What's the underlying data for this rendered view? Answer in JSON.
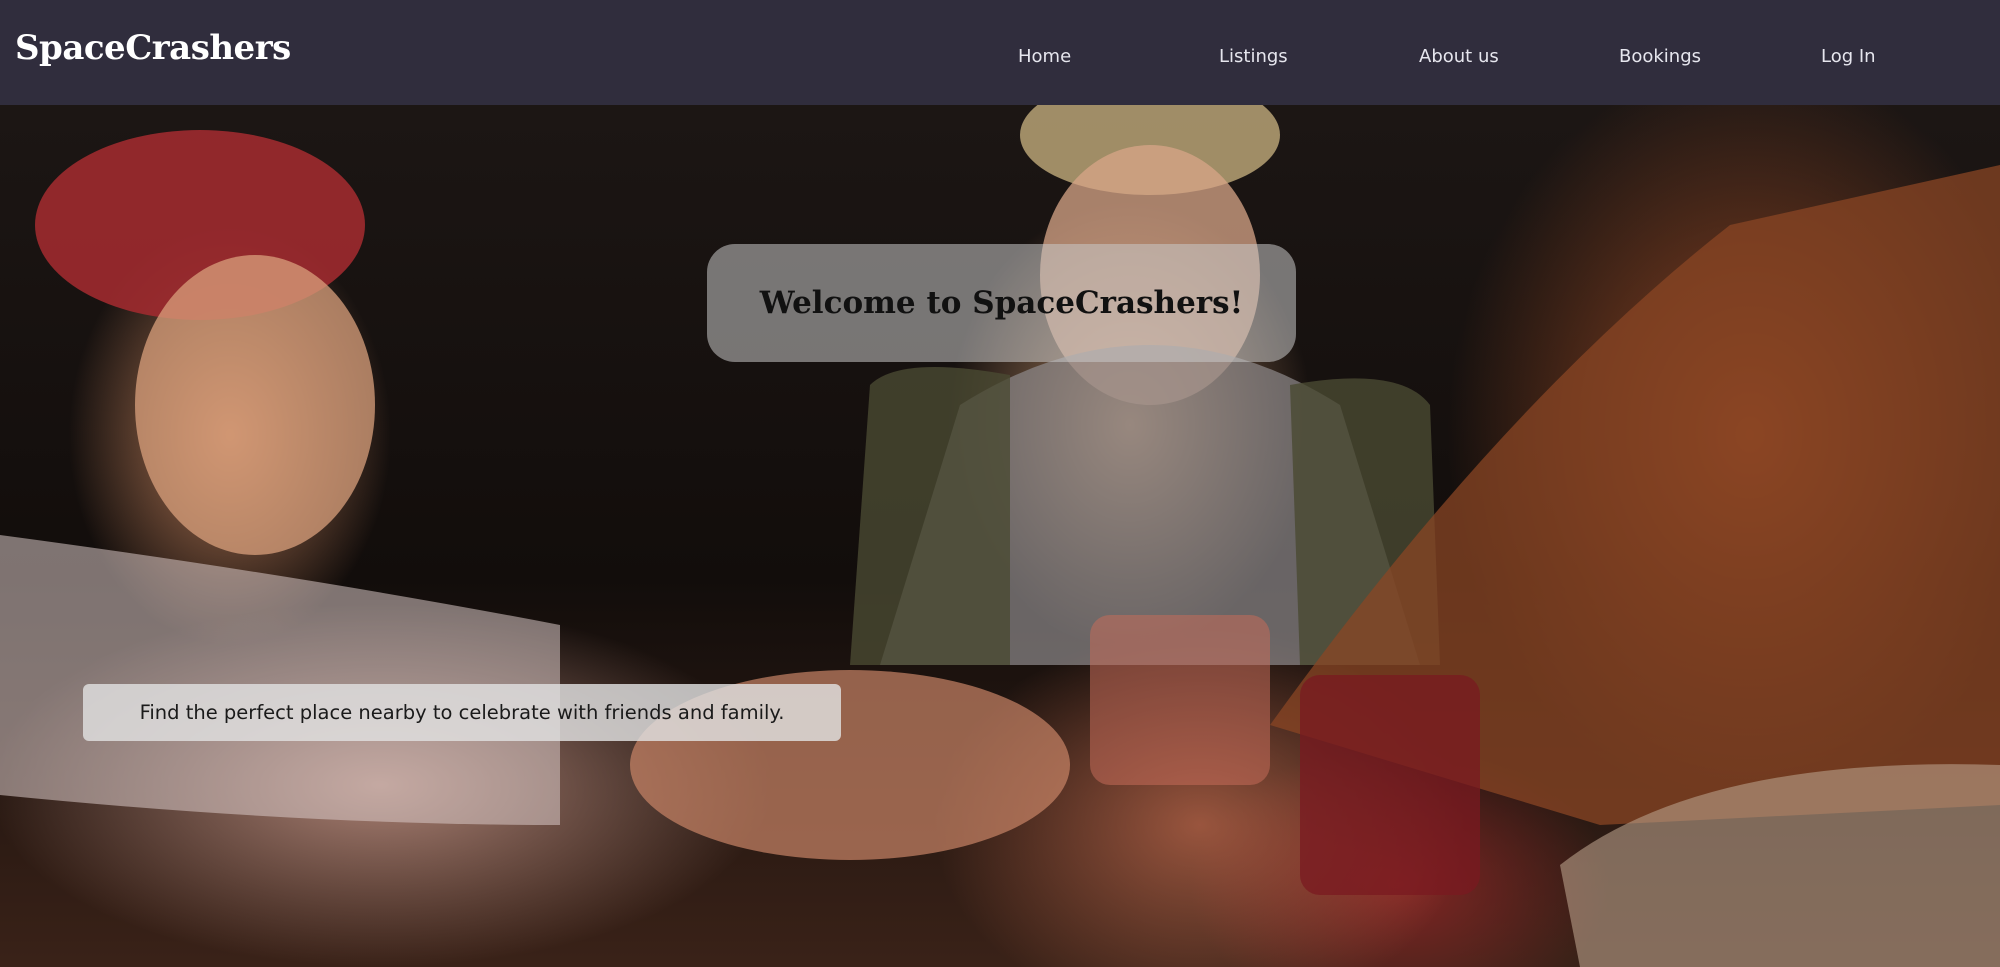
{
  "brand": {
    "name": "SpaceCrashers"
  },
  "nav": {
    "items": [
      {
        "label": "Home"
      },
      {
        "label": "Listings"
      },
      {
        "label": "About us"
      },
      {
        "label": "Bookings"
      },
      {
        "label": "Log In"
      }
    ]
  },
  "hero": {
    "welcome": "Welcome to SpaceCrashers!",
    "tagline": "Find the perfect place nearby to celebrate with friends and family.",
    "image_description_icon": "group-toast-photo"
  },
  "colors": {
    "navbar": "#302d3d",
    "nav_text": "#e6e6ee",
    "brand_text": "#ffffff"
  }
}
